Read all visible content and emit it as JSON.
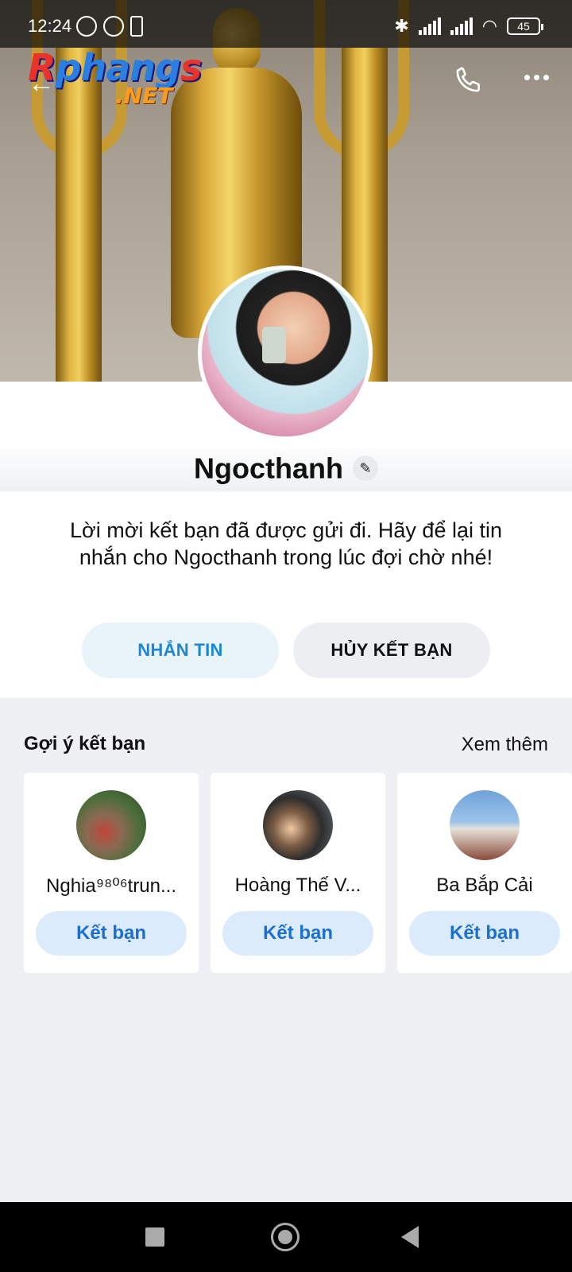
{
  "status_bar": {
    "time": "12:24",
    "battery": "45"
  },
  "watermark": {
    "line1_a": "R",
    "line1_b": "phang",
    "line1_c": "s",
    "line2": ".NET"
  },
  "profile": {
    "name": "Ngocthanh"
  },
  "friend_request": {
    "message": "Lời mời kết bạn đã được gửi đi. Hãy để lại tin nhắn cho Ngocthanh trong lúc đợi chờ nhé!",
    "message_button": "NHẮN TIN",
    "unfriend_button": "HỦY KẾT BẠN"
  },
  "suggestions": {
    "title": "Gợi ý kết bạn",
    "see_more": "Xem thêm",
    "items": [
      {
        "name": "Nghia⁹⁸⁰⁶trun...",
        "button": "Kết bạn"
      },
      {
        "name": "Hoàng Thế V...",
        "button": "Kết bạn"
      },
      {
        "name": "Ba Bắp Cải",
        "button": "Kết bạn"
      }
    ]
  },
  "colors": {
    "accent": "#1b86d6",
    "button_blue_bg": "#dcebfb",
    "background": "#eef0f4"
  }
}
